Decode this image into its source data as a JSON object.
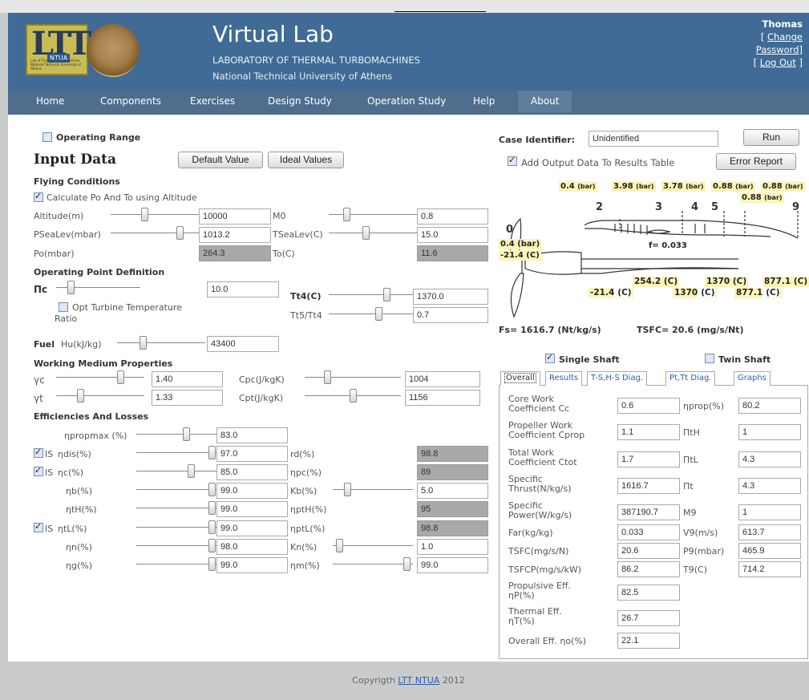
{
  "header": {
    "title": "Virtual Lab",
    "subtitle": "LABORATORY OF THERMAL TURBOMACHINES",
    "subtitle2": "National Technical University of Athens",
    "logo_text": "LTT",
    "logo_badge": "NTUA",
    "logo_small": "Lab of Thermal Turbomachines National Technical University of Athens",
    "user": "Thomas",
    "change_password": "[ Change Password]",
    "change_password_parts": [
      "[ ",
      "Change",
      "Password",
      "]"
    ],
    "logout_parts": [
      "[ ",
      "Log Out",
      " ]"
    ]
  },
  "nav": [
    "Home",
    "Components",
    "Exercises",
    "Design Study",
    "Operation Study",
    "Help",
    "About"
  ],
  "left": {
    "operating_range": "Operating Range",
    "input_data": "Input Data",
    "default_value_btn": "Default Value",
    "ideal_values_btn": "Ideal Values",
    "flying_conditions": "Flying Conditions",
    "calc_po_to": "Calculate Po And To using Altitude",
    "altitude_label": "Altitude(m)",
    "altitude_value": "10000",
    "m0_label": "M0",
    "m0_value": "0.8",
    "psealev_label": "PSeaLev(mbar)",
    "psealev_value": "1013.2",
    "tsealev_label": "TSeaLev(C)",
    "tsealev_value": "15.0",
    "po_label": "Po(mbar)",
    "po_value": "264.3",
    "to_label": "To(C)",
    "to_value": "11.6",
    "opd": "Operating Point Definition",
    "pic_label": "Πc",
    "pic_value": "10.0",
    "tt4_label": "Tt4(C)",
    "tt4_value": "1370.0",
    "opt_turbine": "Opt Turbine Temperature",
    "ratio": "Ratio",
    "tt5tt4_label": "Tt5/Tt4",
    "tt5tt4_value": "0.7",
    "fuel_label": "Fuel",
    "hu_label": "Hu(kJ/kg)",
    "hu_value": "43400",
    "wmp": "Working Medium Properties",
    "gc_label": "γc",
    "gc_value": "1.40",
    "cpc_label": "Cpc(J/kgK)",
    "cpc_value": "1004",
    "gt_label": "γt",
    "gt_value": "1.33",
    "cpt_label": "Cpt(J/kgK)",
    "cpt_value": "1156",
    "eff": "Efficiencies And Losses",
    "npropmax_label": "ηpropmax (%)",
    "npropmax_value": "83.0",
    "is": "IS",
    "ndis_label": "ηdis(%)",
    "ndis_value": "97.0",
    "rd_label": "rd(%)",
    "rd_value": "98.8",
    "nc_label": "ηc(%)",
    "nc_value": "85.0",
    "npc_label": "ηpc(%)",
    "npc_value": "89",
    "nb_label": "ηb(%)",
    "nb_value": "99.0",
    "kb_label": "Kb(%)",
    "kb_value": "5.0",
    "nth_label": "ηtH(%)",
    "nth_value": "99.0",
    "npth_label": "ηptH(%)",
    "npth_value": "95",
    "ntl_label": "ηtL(%)",
    "ntl_value": "99.0",
    "nptl_label": "ηptL(%)",
    "nptl_value": "98.8",
    "nn_label": "ηn(%)",
    "nn_value": "98.0",
    "kn_label": "Kn(%)",
    "kn_value": "1.0",
    "ng_label": "ηg(%)",
    "ng_value": "99.0",
    "nm_label": "ηm(%)",
    "nm_value": "99.0"
  },
  "right": {
    "case_identifier_label": "Case Identifier:",
    "case_identifier_value": "Unidentified",
    "run_btn": "Run",
    "add_output": "Add Output Data To Results Table",
    "error_report_btn": "Error Report",
    "stations": [
      "2",
      "3",
      "4",
      "5",
      "9"
    ],
    "p2": "0.4",
    "p3": "3.98",
    "p4": "3.78",
    "p5": "0.88",
    "p9a": "0.88",
    "p9b": "0.88",
    "bar": "(bar)",
    "p0": "0.4 (bar)",
    "t0": "-21.4 (C)",
    "station0": "0",
    "f": "f= 0.033",
    "t3": "254.2 (C)",
    "t4": "1370 (C)",
    "t5": "877.1 (C)",
    "t2b": "-21.4",
    "t2c": "(C)",
    "t4b": "1370",
    "t5b": "877.1",
    "c": "(C)",
    "fs": "Fs= 1616.7 (Nt/kg/s)",
    "tsfc": "TSFC= 20.6 (mg/s/Nt)",
    "single_shaft": "Single Shaft",
    "twin_shaft": "Twin Shaft",
    "tabs": [
      "Overall",
      "Results",
      "T-S,H-S Diag.",
      "Pt,Tt Diag.",
      "Graphs"
    ],
    "overall": {
      "cc_label": "Core Work Coefficient Cc",
      "cc_l1": "Core Work",
      "cc_l2": "Coefficient Cc",
      "cc_value": "0.6",
      "nprop_label": "ηprop(%)",
      "nprop_value": "80.2",
      "cprop_l1": "Propeller Work",
      "cprop_l2": "Coefficient Cprop",
      "cprop_value": "1.1",
      "pith_label": "ΠtH",
      "pith_value": "1",
      "ctot_l1": "Total Work",
      "ctot_l2": "Coefficient Ctot",
      "ctot_value": "1.7",
      "pitl_label": "ΠtL",
      "pitl_value": "4.3",
      "st_l1": "Specific",
      "st_l2": "Thrust(N/kg/s)",
      "st_value": "1616.7",
      "pit_label": "Πt",
      "pit_value": "4.3",
      "sp_l1": "Specific",
      "sp_l2": "Power(W/kg/s)",
      "sp_value": "387190.7",
      "m9_label": "M9",
      "m9_value": "1",
      "far_label": "Far(kg/kg)",
      "far_value": "0.033",
      "v9_label": "V9(m/s)",
      "v9_value": "613.7",
      "tsfc_label": "TSFC(mg/s/N)",
      "tsfc_value": "20.6",
      "p9_label": "P9(mbar)",
      "p9_value": "465.9",
      "tsfcp_label": "TSFCP(mg/s/kW)",
      "tsfcp_value": "86.2",
      "t9_label": "T9(C)",
      "t9_value": "714.2",
      "pe_l1": "Propulsive Eff.",
      "pe_l2": "ηP(%)",
      "pe_value": "82.5",
      "te_l1": "Thermal Eff.",
      "te_l2": "ηT(%)",
      "te_value": "26.7",
      "oe_label": "Overall Eff. ηo(%)",
      "oe_value": "22.1"
    }
  },
  "footer": {
    "text": "Copyrigth",
    "link": "LTT NTUA",
    "year": "2012"
  }
}
